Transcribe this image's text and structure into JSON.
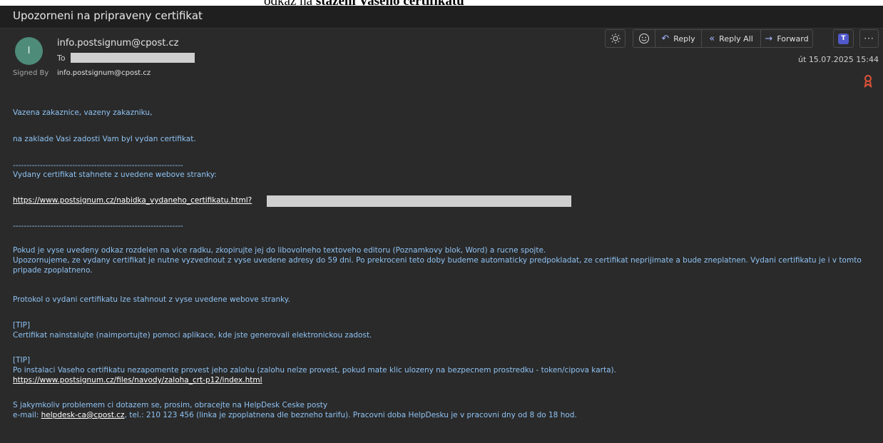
{
  "caption": {
    "prefix": "odkaz na ",
    "bold": "stažení Vašeho certifikátu"
  },
  "message": {
    "subject": "Upozorneni na pripraveny certifikat",
    "avatar_initial": "I",
    "from": "info.postsignum@cpost.cz",
    "to_label": "To",
    "signed_by_label": "Signed By",
    "signed_by_value": "info.postsignum@cpost.cz",
    "date": "út 15.07.2025 15:44"
  },
  "toolbar": {
    "reply": "Reply",
    "reply_all": "Reply All",
    "forward": "Forward"
  },
  "body": {
    "greeting": "Vazena zakaznice, vazeny zakazniku,",
    "intro": "na zaklade Vasi zadosti Vam byl vydan certifikat.",
    "separator": "---------------------------------------------------------------",
    "download_instruction": "Vydany certifikat stahnete z uvedene webove stranky:",
    "cert_url": "https://www.postsignum.cz/nabidka_vydaneho_certifikatu.html?",
    "para_split": "Pokud je vyse uvedeny odkaz rozdelen na vice radku, zkopirujte jej do libovolneho textoveho editoru (Poznamkovy blok, Word) a rucne spojte.",
    "para_warning": "Upozornujeme, ze vydany certifikat je nutne vyzvednout z vyse uvedene adresy do 59 dni. Po prekroceni teto doby budeme automaticky predpokladat, ze certifikat neprijimate a bude zneplatnen. Vydani certifikatu je i v tomto pripade zpoplatneno.",
    "para_protocol": "Protokol o vydani certifikatu lze stahnout z vyse uvedene webove stranky.",
    "tip1_label": "[TIP]",
    "tip1_text": "Certifikat nainstalujte (naimportujte) pomoci aplikace, kde jste generovali elektronickou zadost.",
    "tip2_label": "[TIP]",
    "tip2_text": "Po instalaci Vaseho certifikatu nezapomente provest jeho zalohu (zalohu nelze provest, pokud mate klic ulozeny na bezpecnem prostredku - token/cipova karta).",
    "tip2_url": "https://www.postsignum.cz/files/navody/zaloha_crt-p12/index.html",
    "helpdesk_intro": "S jakymkoliv problemem ci dotazem se, prosim, obracejte na HelpDesk Ceske posty",
    "email_label": "e-mail: ",
    "email_link": "helpdesk-ca@cpost.cz",
    "email_rest": ", tel.: 210 123 456 (linka je zpoplatnena dle bezneho tarifu). Pracovni doba HelpDesku je v pracovni dny od 8 do 18 hod."
  },
  "colors": {
    "background": "#2a2a2a",
    "subject_bar": "#1f1f1f",
    "body_text": "#8fc3f4",
    "avatar": "#4e8b79",
    "accent": "#a5b4ff",
    "teams": "#5059c9",
    "cert_badge": "#e0533a"
  }
}
